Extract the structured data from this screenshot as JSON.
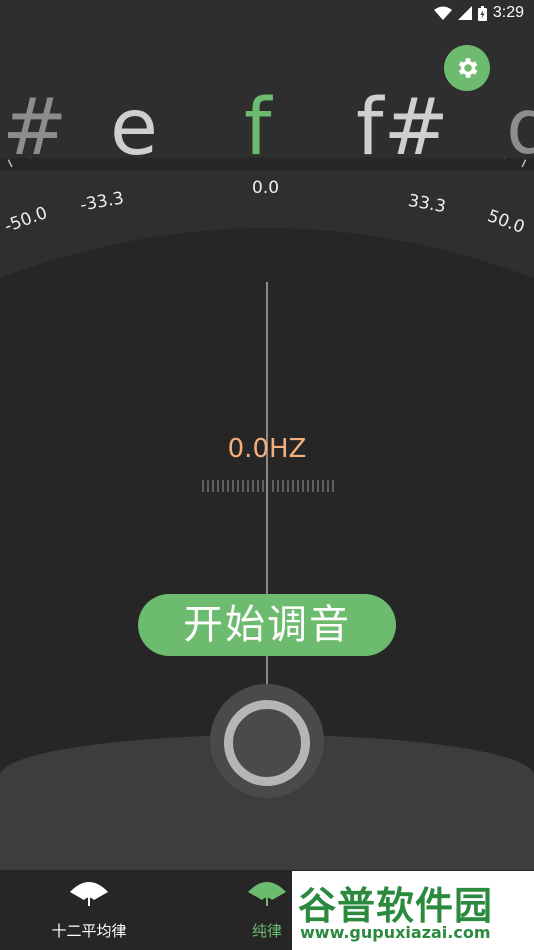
{
  "status_bar": {
    "time": "3:29"
  },
  "notes": {
    "items": [
      {
        "label": "#",
        "state": "dim"
      },
      {
        "label": "e",
        "state": "normal"
      },
      {
        "label": "f",
        "state": "active"
      },
      {
        "label": "f#",
        "state": "normal"
      },
      {
        "label": "g",
        "state": "dim"
      }
    ]
  },
  "settings_icon": "gear-icon",
  "scale": {
    "labels": [
      "-50.0",
      "-33.3",
      "0.0",
      "33.3",
      "50.0"
    ],
    "min": -50,
    "max": 50
  },
  "frequency": {
    "value": "0.0HZ"
  },
  "start_button": {
    "label": "开始调音"
  },
  "bottom_nav": {
    "items": [
      {
        "label": "十二平均律",
        "icon": "gauge-icon",
        "active": false
      },
      {
        "label": "纯律",
        "icon": "gauge-icon",
        "active": true
      }
    ]
  },
  "watermark": {
    "title": "谷普软件园",
    "url": "www.gupuxiazai.com"
  },
  "colors": {
    "accent": "#6cbb6f",
    "frequency": "#f3b07d",
    "background": "#262626"
  }
}
